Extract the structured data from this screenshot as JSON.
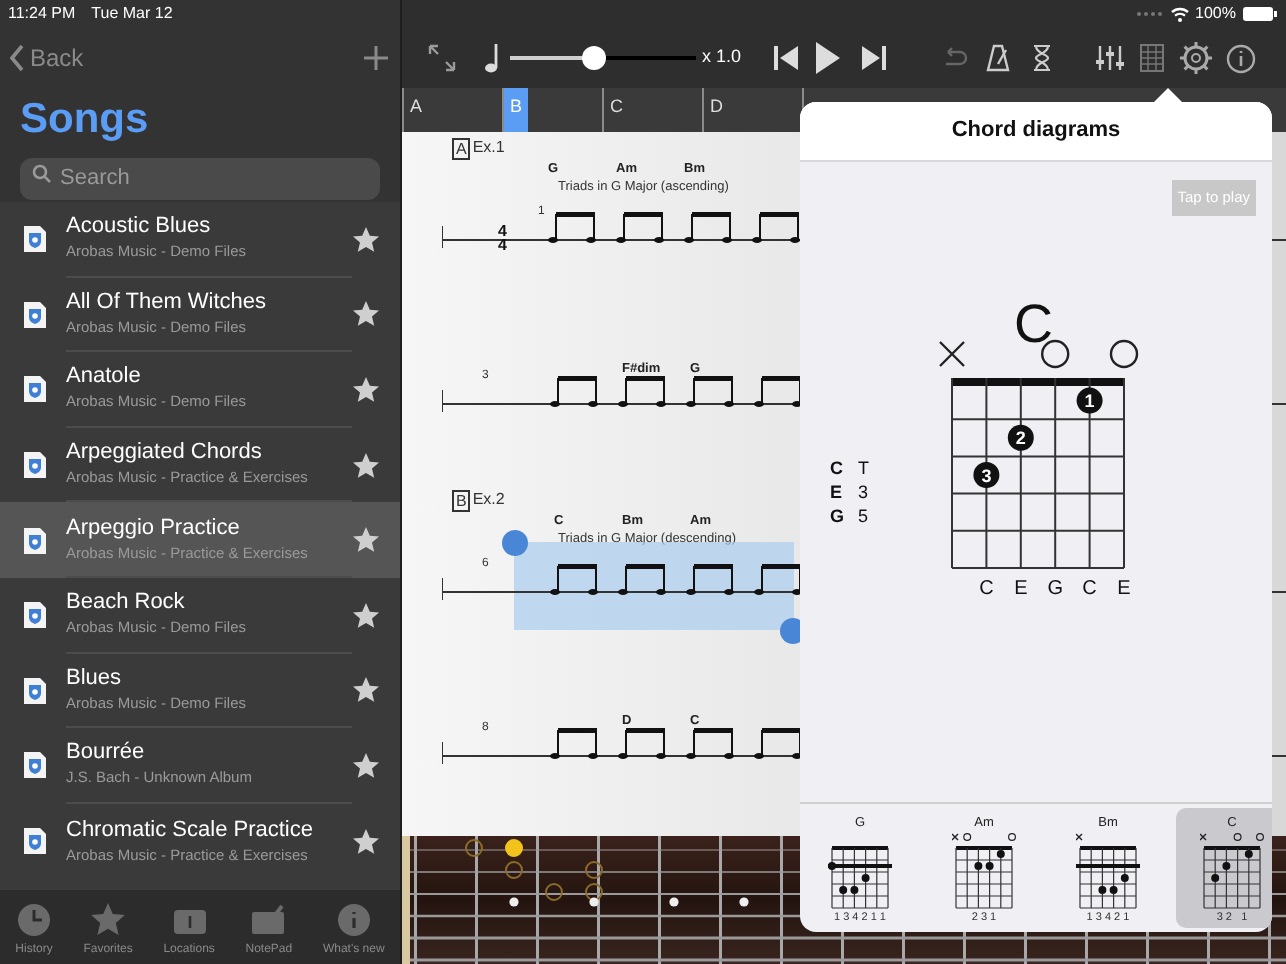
{
  "status_bar": {
    "time": "11:24 PM",
    "date": "Tue Mar 12",
    "battery": "100%"
  },
  "sidebar": {
    "back": "Back",
    "title": "Songs",
    "search": {
      "placeholder": "Search"
    },
    "songs": [
      {
        "title": "Acoustic Blues",
        "subtitle": "Arobas Music - Demo Files",
        "selected": false
      },
      {
        "title": "All Of Them Witches",
        "subtitle": "Arobas Music - Demo Files",
        "selected": false
      },
      {
        "title": "Anatole",
        "subtitle": "Arobas Music - Demo Files",
        "selected": false
      },
      {
        "title": "Arpeggiated Chords",
        "subtitle": "Arobas Music - Practice & Exercises",
        "selected": false
      },
      {
        "title": "Arpeggio Practice",
        "subtitle": "Arobas Music - Practice & Exercises",
        "selected": true
      },
      {
        "title": "Beach Rock",
        "subtitle": "Arobas Music - Demo Files",
        "selected": false
      },
      {
        "title": "Blues",
        "subtitle": "Arobas Music - Demo Files",
        "selected": false
      },
      {
        "title": "Bourrée",
        "subtitle": "J.S. Bach - Unknown Album",
        "selected": false
      },
      {
        "title": "Chromatic Scale Practice",
        "subtitle": "Arobas Music - Practice & Exercises",
        "selected": false
      }
    ],
    "tabs": [
      {
        "label": "History",
        "kind": "clock"
      },
      {
        "label": "Favorites",
        "kind": "star"
      },
      {
        "label": "Locations",
        "kind": "folder"
      },
      {
        "label": "NotePad",
        "kind": "pad"
      },
      {
        "label": "What's new",
        "kind": "info"
      }
    ]
  },
  "toolbar": {
    "speed": {
      "level": 0.45,
      "reading": "x 1.0"
    }
  },
  "sections": [
    {
      "label": "A",
      "selected": false
    },
    {
      "label": "B",
      "selected": true
    },
    {
      "label": "C",
      "selected": false
    },
    {
      "label": "D",
      "selected": false
    }
  ],
  "score": {
    "systems": [
      {
        "section": "A",
        "name": "Ex.1",
        "bar": "1",
        "time_signature": [
          "4",
          "4"
        ],
        "caption": "Triads in G Major (ascending)",
        "chords": [
          "G",
          "Am",
          "Bm"
        ],
        "selected": false
      },
      {
        "bar": "3",
        "chords": [
          "F#dim",
          "G"
        ],
        "selected": false
      },
      {
        "section": "B",
        "name": "Ex.2",
        "bar": "6",
        "caption": "Triads in G Major (descending)",
        "chords": [
          "C",
          "Bm",
          "Am"
        ],
        "selected": true
      },
      {
        "bar": "8",
        "chords": [
          "D",
          "C"
        ],
        "selected": false
      }
    ]
  },
  "chord_popover": {
    "title": "Chord diagrams",
    "play_button": "Tap to play",
    "chord": {
      "name": "C",
      "intervals": [
        {
          "note": "C",
          "interval": "T"
        },
        {
          "note": "E",
          "interval": "3"
        },
        {
          "note": "G",
          "interval": "5"
        }
      ],
      "strings": [
        {
          "kind": "muted"
        },
        {
          "kind": "fretted",
          "finger": "3",
          "note": "C"
        },
        {
          "kind": "fretted",
          "finger": "2",
          "note": "E"
        },
        {
          "kind": "open",
          "note": "G"
        },
        {
          "kind": "fretted",
          "finger": "1",
          "note": "C"
        },
        {
          "kind": "open",
          "note": "E"
        }
      ]
    },
    "thumbnails": [
      {
        "name": "G",
        "fingering": "1 3 4 2 1 1",
        "selected": false
      },
      {
        "name": "Am",
        "fingering": "2 3 1",
        "selected": false
      },
      {
        "name": "Bm",
        "fingering": "1 3 4 2 1",
        "selected": false
      },
      {
        "name": "C",
        "fingering": "3 2   1",
        "selected": true
      }
    ]
  }
}
